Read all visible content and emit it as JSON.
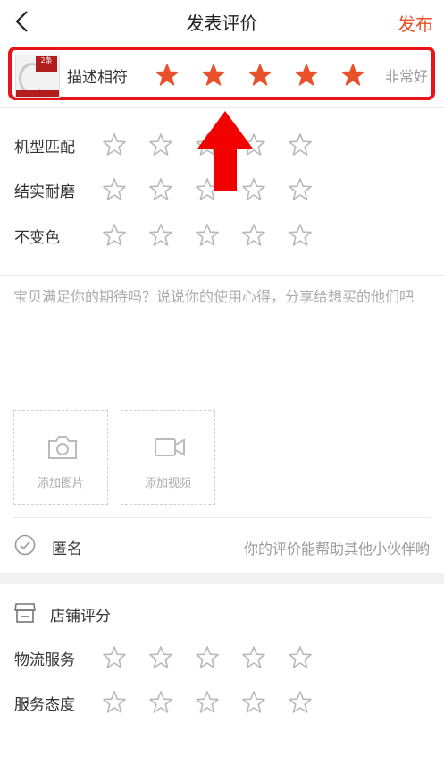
{
  "header": {
    "title": "发表评价",
    "publish_label": "发布"
  },
  "product": {
    "thumb_badge": "2条"
  },
  "description_rating": {
    "label": "描述相符",
    "stars": 5,
    "max": 5,
    "rating_text": "非常好"
  },
  "product_ratings": [
    {
      "label": "机型匹配",
      "stars": 0,
      "max": 5
    },
    {
      "label": "结实耐磨",
      "stars": 0,
      "max": 5
    },
    {
      "label": "不变色",
      "stars": 0,
      "max": 5
    }
  ],
  "review": {
    "placeholder": "宝贝满足你的期待吗？说说你的使用心得，分享给想买的他们吧"
  },
  "media": {
    "add_photo_label": "添加图片",
    "add_video_label": "添加视频"
  },
  "anonymous": {
    "label": "匿名",
    "hint": "你的评价能帮助其他小伙伴哟"
  },
  "store": {
    "title": "店铺评分",
    "ratings": [
      {
        "label": "物流服务",
        "stars": 0,
        "max": 5
      },
      {
        "label": "服务态度",
        "stars": 0,
        "max": 5
      }
    ]
  },
  "colors": {
    "accent": "#e8512a",
    "star_filled": "#e8512a",
    "star_empty": "#b8b8b8",
    "highlight_box": "#e8141a",
    "arrow": "#f20000"
  }
}
